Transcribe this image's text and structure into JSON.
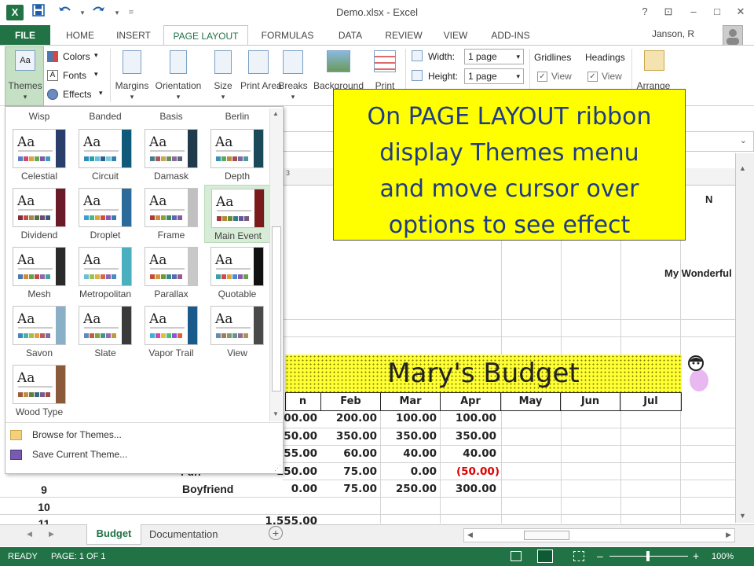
{
  "window": {
    "title": "Demo.xlsx - Excel",
    "help": "?",
    "restore": "⊡",
    "minimize": "–",
    "maximize": "□",
    "close": "✕"
  },
  "quick_access": {
    "save_icon": "save-icon",
    "undo_icon": "undo-icon",
    "redo_icon": "redo-icon",
    "customize": "="
  },
  "tabs": [
    "FILE",
    "HOME",
    "INSERT",
    "PAGE LAYOUT",
    "FORMULAS",
    "DATA",
    "REVIEW",
    "VIEW",
    "ADD-INS"
  ],
  "user": {
    "name": "Janson, R"
  },
  "ribbon": {
    "themes": "Themes",
    "colors": "Colors",
    "fonts": "Fonts",
    "effects": "Effects",
    "margins": "Margins",
    "orientation": "Orientation",
    "size": "Size",
    "print_area": "Print Area",
    "breaks": "Breaks",
    "background": "Background",
    "print_titles": "Print",
    "width_label": "Width:",
    "width_value": "1 page",
    "height_label": "Height:",
    "height_value": "1 page",
    "gridlines": "Gridlines",
    "headings": "Headings",
    "view1": "View",
    "view2": "View",
    "arrange": "Arrange"
  },
  "themes_menu": {
    "partial_row": [
      "Wisp",
      "Banded",
      "Basis",
      "Berlin"
    ],
    "themes": [
      {
        "name": "Celestial",
        "bar": "#2a3e6b",
        "sw": [
          "#5b7ec9",
          "#d04a6a",
          "#e0a040",
          "#6aa84f",
          "#7d5ba6",
          "#3d9bc1"
        ]
      },
      {
        "name": "Circuit",
        "bar": "#0f5a7a",
        "sw": [
          "#2e8bc0",
          "#1fa3a8",
          "#5fc0e0",
          "#2a5f8f",
          "#7bc9d6",
          "#3b7fa8"
        ]
      },
      {
        "name": "Damask",
        "bar": "#1f3a4a",
        "sw": [
          "#4a7b8c",
          "#a25a5a",
          "#c9a64b",
          "#6a8e5a",
          "#8a6a9a",
          "#5a6a7a"
        ]
      },
      {
        "name": "Depth",
        "bar": "#1a4a5a",
        "sw": [
          "#3b8fb0",
          "#5aa85a",
          "#c08a3a",
          "#a05050",
          "#7a6aa0",
          "#4a9a9a"
        ]
      },
      {
        "name": "Dividend",
        "bar": "#6b1a2a",
        "sw": [
          "#8a2a3a",
          "#c0503a",
          "#a08a4a",
          "#5a6a3a",
          "#6a4a7a",
          "#3a5a7a"
        ]
      },
      {
        "name": "Droplet",
        "bar": "#2a6b9a",
        "sw": [
          "#3aa0d0",
          "#4ab87a",
          "#e0a03a",
          "#d0503a",
          "#8a5ab0",
          "#3a7ab0"
        ]
      },
      {
        "name": "Frame",
        "bar": "#c0c0c0",
        "sw": [
          "#b03a3a",
          "#d08a3a",
          "#8aa03a",
          "#3a8a6a",
          "#5a6ab0",
          "#8a5aa0"
        ]
      },
      {
        "name": "Main Event",
        "bar": "#7a1a1a",
        "sw": [
          "#a03a3a",
          "#b08a3a",
          "#6a8a3a",
          "#3a7a8a",
          "#5a5aa0",
          "#7a5a7a"
        ]
      },
      {
        "name": "Mesh",
        "bar": "#2a2a2a",
        "sw": [
          "#4a7ab0",
          "#d08a3a",
          "#6aa04a",
          "#c04a4a",
          "#8a6ab0",
          "#4aa0a0"
        ]
      },
      {
        "name": "Metropolitan",
        "bar": "#4ab0c0",
        "sw": [
          "#6ac0d0",
          "#a0c04a",
          "#e0b04a",
          "#d06a4a",
          "#8a6ab0",
          "#4a8ac0"
        ]
      },
      {
        "name": "Parallax",
        "bar": "#c8c8c8",
        "sw": [
          "#c0503a",
          "#d09a3a",
          "#6a9a3a",
          "#3a8a8a",
          "#5a6ab0",
          "#9a5a8a"
        ]
      },
      {
        "name": "Quotable",
        "bar": "#111111",
        "sw": [
          "#3aa0a0",
          "#d04a4a",
          "#e0a03a",
          "#4a8ad0",
          "#8a5ab0",
          "#6aa04a"
        ]
      },
      {
        "name": "Savon",
        "bar": "#8ab0c8",
        "sw": [
          "#3a8ac0",
          "#4ab0a0",
          "#a0c04a",
          "#e0a03a",
          "#c05a5a",
          "#7a6ab0"
        ]
      },
      {
        "name": "Slate",
        "bar": "#3a3a3a",
        "sw": [
          "#5a8ac0",
          "#c0603a",
          "#8aa03a",
          "#3a9a8a",
          "#9a6ab0",
          "#c09a3a"
        ]
      },
      {
        "name": "Vapor Trail",
        "bar": "#1a5a8a",
        "sw": [
          "#3ab0e0",
          "#d04aa0",
          "#e0c03a",
          "#4ac07a",
          "#8a5ad0",
          "#e0603a"
        ]
      },
      {
        "name": "View",
        "bar": "#4a4a4a",
        "sw": [
          "#6a8ab0",
          "#a07a5a",
          "#8a9a5a",
          "#5a9a9a",
          "#9a6a8a",
          "#b0905a"
        ]
      },
      {
        "name": "Wood Type",
        "bar": "#8a5a3a",
        "sw": [
          "#a05a3a",
          "#c08a4a",
          "#6a7a3a",
          "#3a6a7a",
          "#7a5a8a",
          "#9a4a4a"
        ]
      }
    ],
    "browse": "Browse for Themes...",
    "save_current": "Save Current Theme..."
  },
  "callout": {
    "lines": [
      "On PAGE LAYOUT ribbon",
      "display Themes menu",
      "and move cursor over",
      "options to see effect"
    ]
  },
  "sheet": {
    "col_header_visible": "N",
    "heading": "My Wonderful",
    "title": "Mary's Budget",
    "months": [
      "Feb",
      "Mar",
      "Apr",
      "May",
      "Jun",
      "Jul"
    ],
    "partial_month": "n",
    "row_numbers": [
      "9",
      "10",
      "11"
    ],
    "row8_label_partial": "Fun",
    "row9_label": "Boyfriend",
    "rows": [
      {
        "jan": "00.00",
        "feb": "200.00",
        "mar": "100.00",
        "apr": "100.00"
      },
      {
        "jan": "50.00",
        "feb": "350.00",
        "mar": "350.00",
        "apr": "350.00"
      },
      {
        "jan": "55.00",
        "feb": "60.00",
        "mar": "40.00",
        "apr": "40.00"
      },
      {
        "jan": "150.00",
        "feb": "75.00",
        "mar": "0.00",
        "apr": "(50.00)"
      },
      {
        "jan": "0.00",
        "feb": "75.00",
        "mar": "250.00",
        "apr": "300.00"
      }
    ],
    "row11_partial": "1,555.00",
    "col3_hint": "3"
  },
  "sheet_tabs": {
    "active": "Budget",
    "other": "Documentation",
    "add": "+"
  },
  "status": {
    "ready": "READY",
    "page": "PAGE: 1 OF 1",
    "zoom": "100%",
    "minus": "–",
    "plus": "+"
  }
}
